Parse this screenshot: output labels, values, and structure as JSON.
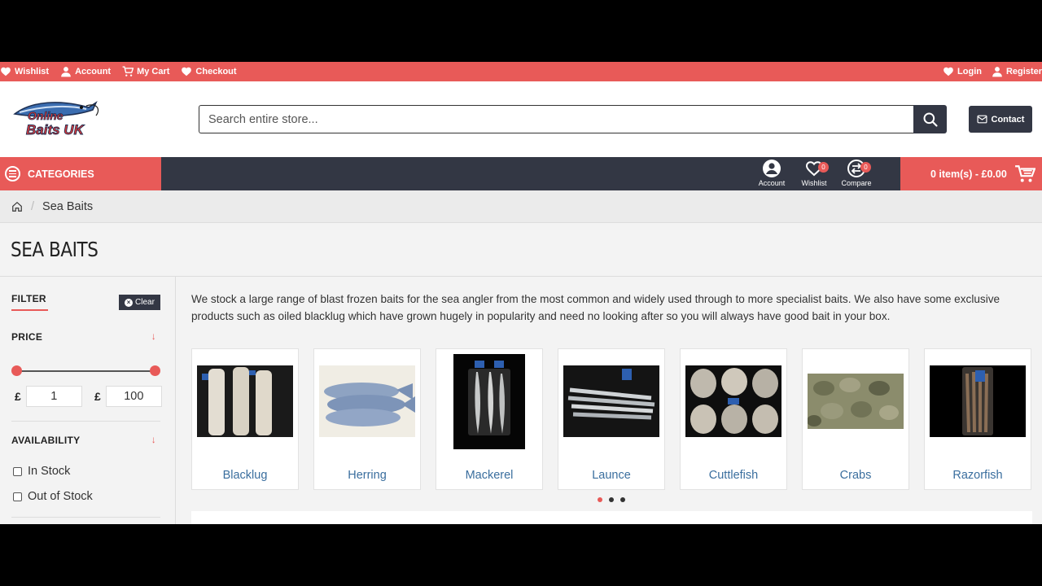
{
  "topbar": {
    "left": [
      "Wishlist",
      "Account",
      "My Cart",
      "Checkout"
    ],
    "login": "Login",
    "register": "Register"
  },
  "header": {
    "logo_text": "Online Baits UK",
    "search_placeholder": "Search entire store...",
    "contact": "Contact"
  },
  "navbar": {
    "categories": "CATEGORIES",
    "account": "Account",
    "wishlist": "Wishlist",
    "wishlist_count": "0",
    "compare": "Compare",
    "compare_count": "0",
    "cart": "0 item(s) - £0.00"
  },
  "breadcrumb": {
    "current": "Sea Baits"
  },
  "page": {
    "title": "SEA BAITS"
  },
  "filter": {
    "title": "FILTER",
    "clear": "Clear",
    "price": {
      "label": "PRICE",
      "currency": "£",
      "min": "1",
      "max": "100"
    },
    "availability": {
      "label": "AVAILABILITY",
      "options": [
        "In Stock",
        "Out of Stock"
      ]
    }
  },
  "intro": "We stock a large range of blast frozen baits for the sea angler from the most common and widely used through to more specialist baits. We also have some exclusive products such as oiled blacklug which have grown hugely in popularity and need no looking after so you will always have good bait in your box.",
  "products": [
    "Blacklug",
    "Herring",
    "Mackerel",
    "Launce",
    "Cuttlefish",
    "Crabs",
    "Razorfish"
  ],
  "colors": {
    "accent": "#e85a58",
    "dark": "#333744",
    "link": "#3a6e9e"
  }
}
